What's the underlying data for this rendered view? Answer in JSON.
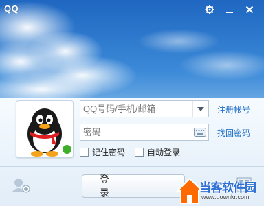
{
  "window": {
    "title": "QQ",
    "settings_icon": "gear-icon",
    "minimize_icon": "minimize-icon",
    "close_icon": "close-icon"
  },
  "login": {
    "account_placeholder": "QQ号码/手机/邮箱",
    "password_placeholder": "密码",
    "register_link": "注册帐号",
    "recover_link": "找回密码",
    "remember_label": "记住密码",
    "auto_login_label": "自动登录",
    "login_button": "登　　录",
    "status_color": "#3fae2a"
  },
  "footer": {
    "multi_account_icon": "multi-account-icon",
    "qr_icon": "qr-code-icon"
  },
  "watermark": {
    "text": "当客软件园",
    "url": "www.downkr.com"
  },
  "colors": {
    "link": "#1f6fc5",
    "sky_top": "#1f6cc4",
    "sky_bottom": "#cfe6fb"
  }
}
